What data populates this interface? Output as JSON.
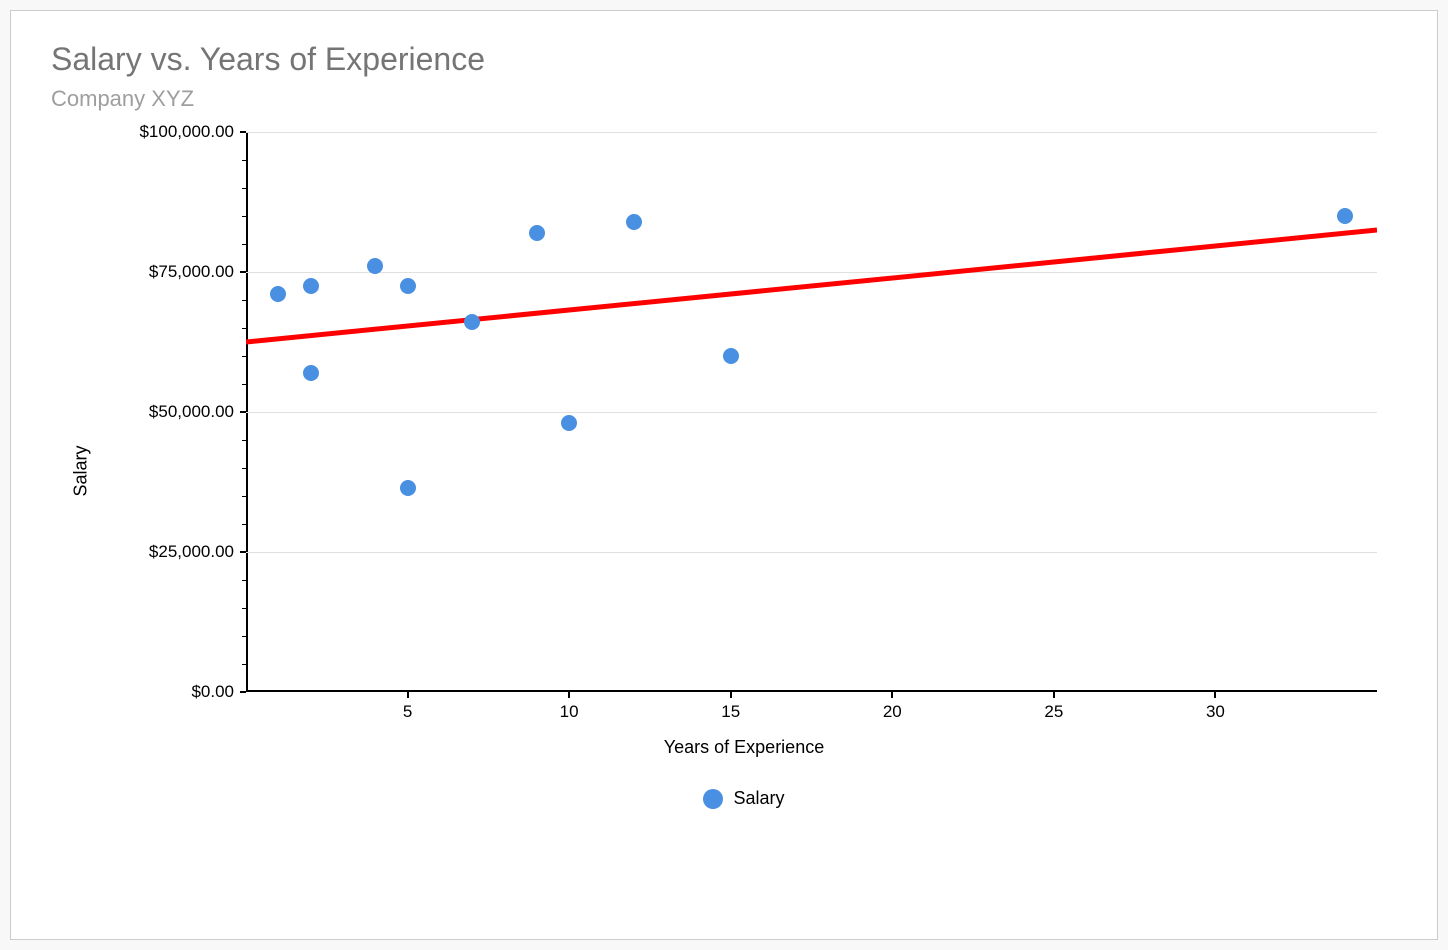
{
  "chart_data": {
    "type": "scatter",
    "title": "Salary vs. Years of Experience",
    "subtitle": "Company XYZ",
    "xlabel": "Years of Experience",
    "ylabel": "Salary",
    "legend_label": "Salary",
    "xlim": [
      0,
      35
    ],
    "ylim": [
      0,
      100000
    ],
    "x_ticks": [
      5,
      10,
      15,
      20,
      25,
      30
    ],
    "y_ticks": [
      {
        "value": 0,
        "label": "$0.00"
      },
      {
        "value": 25000,
        "label": "$25,000.00"
      },
      {
        "value": 50000,
        "label": "$50,000.00"
      },
      {
        "value": 75000,
        "label": "$75,000.00"
      },
      {
        "value": 100000,
        "label": "$100,000.00"
      }
    ],
    "series": [
      {
        "name": "Salary",
        "points": [
          {
            "x": 1,
            "y": 71000
          },
          {
            "x": 2,
            "y": 72500
          },
          {
            "x": 2,
            "y": 57000
          },
          {
            "x": 4,
            "y": 76000
          },
          {
            "x": 5,
            "y": 72500
          },
          {
            "x": 5,
            "y": 36500
          },
          {
            "x": 7,
            "y": 66000
          },
          {
            "x": 9,
            "y": 82000
          },
          {
            "x": 10,
            "y": 48000
          },
          {
            "x": 12,
            "y": 84000
          },
          {
            "x": 15,
            "y": 60000
          },
          {
            "x": 34,
            "y": 85000
          }
        ]
      }
    ],
    "trendline": {
      "start": {
        "x": 0,
        "y": 62500
      },
      "end": {
        "x": 35,
        "y": 82500
      },
      "color": "#ff0000"
    },
    "colors": {
      "point": "#4a90e2",
      "trendline": "#ff0000",
      "grid": "#e0e0e0"
    }
  }
}
